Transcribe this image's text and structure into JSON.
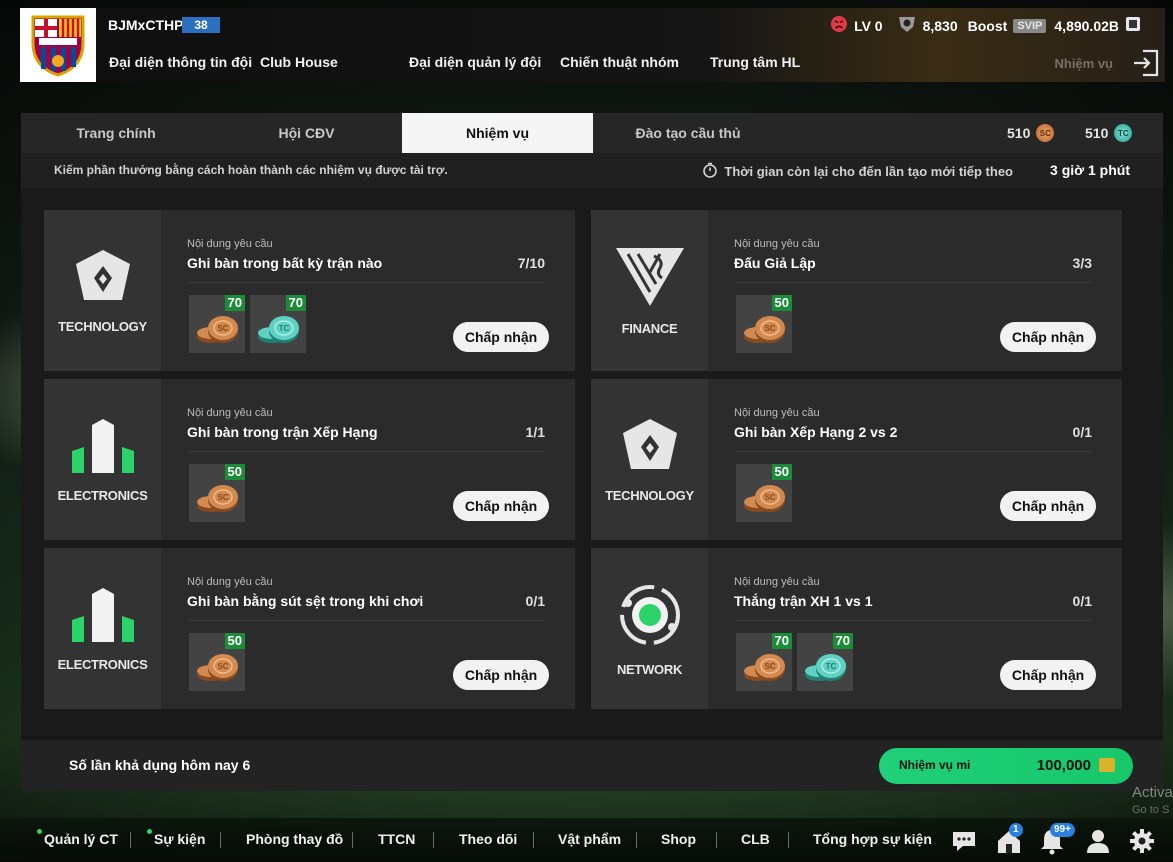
{
  "header": {
    "username": "BJMxCTHP",
    "level_badge": "38",
    "nav": [
      "Đại diện thông tin đội",
      "Club House",
      "Đại diện quản lý đội",
      "Chiến thuật nhóm",
      "Trung tâm HL"
    ],
    "lv": "LV 0",
    "points": "8,830",
    "boost_label": "Boost",
    "svip_label": "SVIP",
    "balance": "4,890.02B",
    "ghost_label": "Nhiệm vụ"
  },
  "tabs": {
    "items": [
      "Trang chính",
      "Hội CĐV",
      "Nhiệm vụ",
      "Đào tạo cầu thủ"
    ],
    "active_index": 2,
    "sc_amount": "510",
    "tc_amount": "510"
  },
  "subheader": {
    "description": "Kiếm phần thưởng bằng cách hoàn thành các nhiệm vụ được tài trợ.",
    "timer_label": "Thời gian còn lại cho đến lần tạo mới tiếp theo",
    "timer_value": "3 giờ 1 phút"
  },
  "missions": [
    {
      "sponsor": "TECHNOLOGY",
      "sponsor_icon": "technology-logo",
      "req_label": "Nội dung yêu cầu",
      "title": "Ghi bàn trong bất kỳ trận nào",
      "progress": "7/10",
      "rewards": [
        {
          "type": "sc",
          "amount": "70",
          "coin_label": "SC"
        },
        {
          "type": "tc",
          "amount": "70",
          "coin_label": "TC"
        }
      ],
      "button": "Chấp nhận"
    },
    {
      "sponsor": "FINANCE",
      "sponsor_icon": "finance-logo",
      "req_label": "Nội dung yêu cầu",
      "title": "Đấu Giả Lập",
      "progress": "3/3",
      "rewards": [
        {
          "type": "sc",
          "amount": "50",
          "coin_label": "SC"
        }
      ],
      "button": "Chấp nhận"
    },
    {
      "sponsor": "ELECTRONICS",
      "sponsor_icon": "electronics-logo",
      "req_label": "Nội dung yêu cầu",
      "title": "Ghi bàn trong trận Xếp Hạng",
      "progress": "1/1",
      "rewards": [
        {
          "type": "sc",
          "amount": "50",
          "coin_label": "SC"
        }
      ],
      "button": "Chấp nhận"
    },
    {
      "sponsor": "TECHNOLOGY",
      "sponsor_icon": "technology-logo",
      "req_label": "Nội dung yêu cầu",
      "title": "Ghi bàn Xếp Hạng 2 vs 2",
      "progress": "0/1",
      "rewards": [
        {
          "type": "sc",
          "amount": "50",
          "coin_label": "SC"
        }
      ],
      "button": "Chấp nhận"
    },
    {
      "sponsor": "ELECTRONICS",
      "sponsor_icon": "electronics-logo",
      "req_label": "Nội dung yêu cầu",
      "title": "Ghi bàn bằng sút sệt trong khi chơi",
      "progress": "0/1",
      "rewards": [
        {
          "type": "sc",
          "amount": "50",
          "coin_label": "SC"
        }
      ],
      "button": "Chấp nhận"
    },
    {
      "sponsor": "NETWORK",
      "sponsor_icon": "network-logo",
      "req_label": "Nội dung yêu cầu",
      "title": "Thắng trận XH 1 vs 1",
      "progress": "0/1",
      "rewards": [
        {
          "type": "sc",
          "amount": "70",
          "coin_label": "SC"
        },
        {
          "type": "tc",
          "amount": "70",
          "coin_label": "TC"
        }
      ],
      "button": "Chấp nhận"
    }
  ],
  "footer": {
    "daily_uses": "Số lần khả dụng hôm nay 6",
    "mission_button_label": "Nhiệm vụ mi",
    "mission_button_value": "100,000"
  },
  "bottom_nav": {
    "items": [
      "Quản lý CT",
      "Sự kiện",
      "Phòng thay đồ",
      "TTCN",
      "Theo dõi",
      "Vật phẩm",
      "Shop",
      "CLB",
      "Tổng hợp sự kiện"
    ],
    "home_badge": "1",
    "bell_badge": "99+"
  },
  "watermark": {
    "line1": "Activa",
    "line2": "Go to S"
  },
  "colors": {
    "accent_green": "#1fcf72",
    "sc_coin": "#c4733a",
    "tc_coin": "#3fb6a8",
    "reward_badge": "#1d8c3a"
  }
}
